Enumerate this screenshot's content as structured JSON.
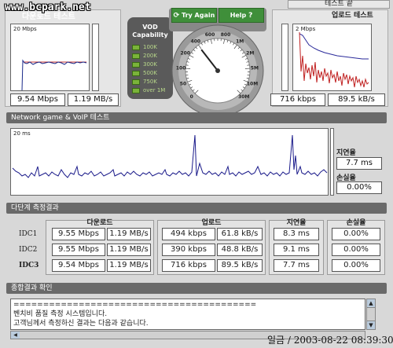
{
  "watermark": "www.bcpark.net",
  "end_test_button": "테스트 끝",
  "download": {
    "title": "다운로드 테스트",
    "scale": "20 Mbps",
    "speed_value": "9.54 Mbps",
    "bytes_value": "1.19 MB/s"
  },
  "upload": {
    "title": "업로드 테스트",
    "scale": "2 Mbps",
    "speed_value": "716 kbps",
    "bytes_value": "89.5 kB/s"
  },
  "gauge": {
    "try_again": "Try Again",
    "help": "Help",
    "tick_labels": [
      "0",
      "50",
      "100",
      "200",
      "400",
      "600",
      "800",
      "1M",
      "2M",
      "5M",
      "10M",
      "30M"
    ],
    "needle_fraction": 0.36
  },
  "vod": {
    "title": "VOD Capability",
    "levels": [
      "100K",
      "200K",
      "300K",
      "500K",
      "750K",
      "over 1M"
    ]
  },
  "latency": {
    "section_title": "Network game & VoIP 테스트",
    "scale": "20 ms",
    "delay_label": "지연율",
    "delay_value": "7.7 ms",
    "loss_label": "손실율",
    "loss_value": "0.00%"
  },
  "multi": {
    "section_title": "다단계 측정결과",
    "download_head": "다운로드",
    "upload_head": "업로드",
    "delay_head": "지연율",
    "loss_head": "손실율",
    "rows": [
      {
        "label": "IDC1",
        "dl_speed": "9.55 Mbps",
        "dl_bytes": "1.19 MB/s",
        "ul_speed": "494 kbps",
        "ul_bytes": "61.8 kB/s",
        "delay": "8.3 ms",
        "loss": "0.00%"
      },
      {
        "label": "IDC2",
        "dl_speed": "9.55 Mbps",
        "dl_bytes": "1.19 MB/s",
        "ul_speed": "390 kbps",
        "ul_bytes": "48.8 kB/s",
        "delay": "9.1 ms",
        "loss": "0.00%"
      },
      {
        "label": "IDC3",
        "dl_speed": "9.54 Mbps",
        "dl_bytes": "1.19 MB/s",
        "ul_speed": "716 kbps",
        "ul_bytes": "89.5 kB/s",
        "delay": "7.7 ms",
        "loss": "0.00%"
      }
    ]
  },
  "summary": {
    "section_title": "종합결과 확인",
    "lines": [
      "=========================================",
      "벤치비 품질 측정 시스템입니다.",
      "고객님께서 측정하신 결과는 다음과 같습니다."
    ]
  },
  "footer": {
    "caption": "일금 / 2003-08-22 08:39:30"
  },
  "colors": {
    "background": "#d8d8d8",
    "section_bar": "#6a6a6a",
    "button_green": "#3f8f3a",
    "download_line": "#1a2a8a",
    "download_avg": "#c03030",
    "upload_line": "#c02020",
    "upload_avg": "#2a2a9a",
    "latency_line": "#1a1a8a"
  }
}
